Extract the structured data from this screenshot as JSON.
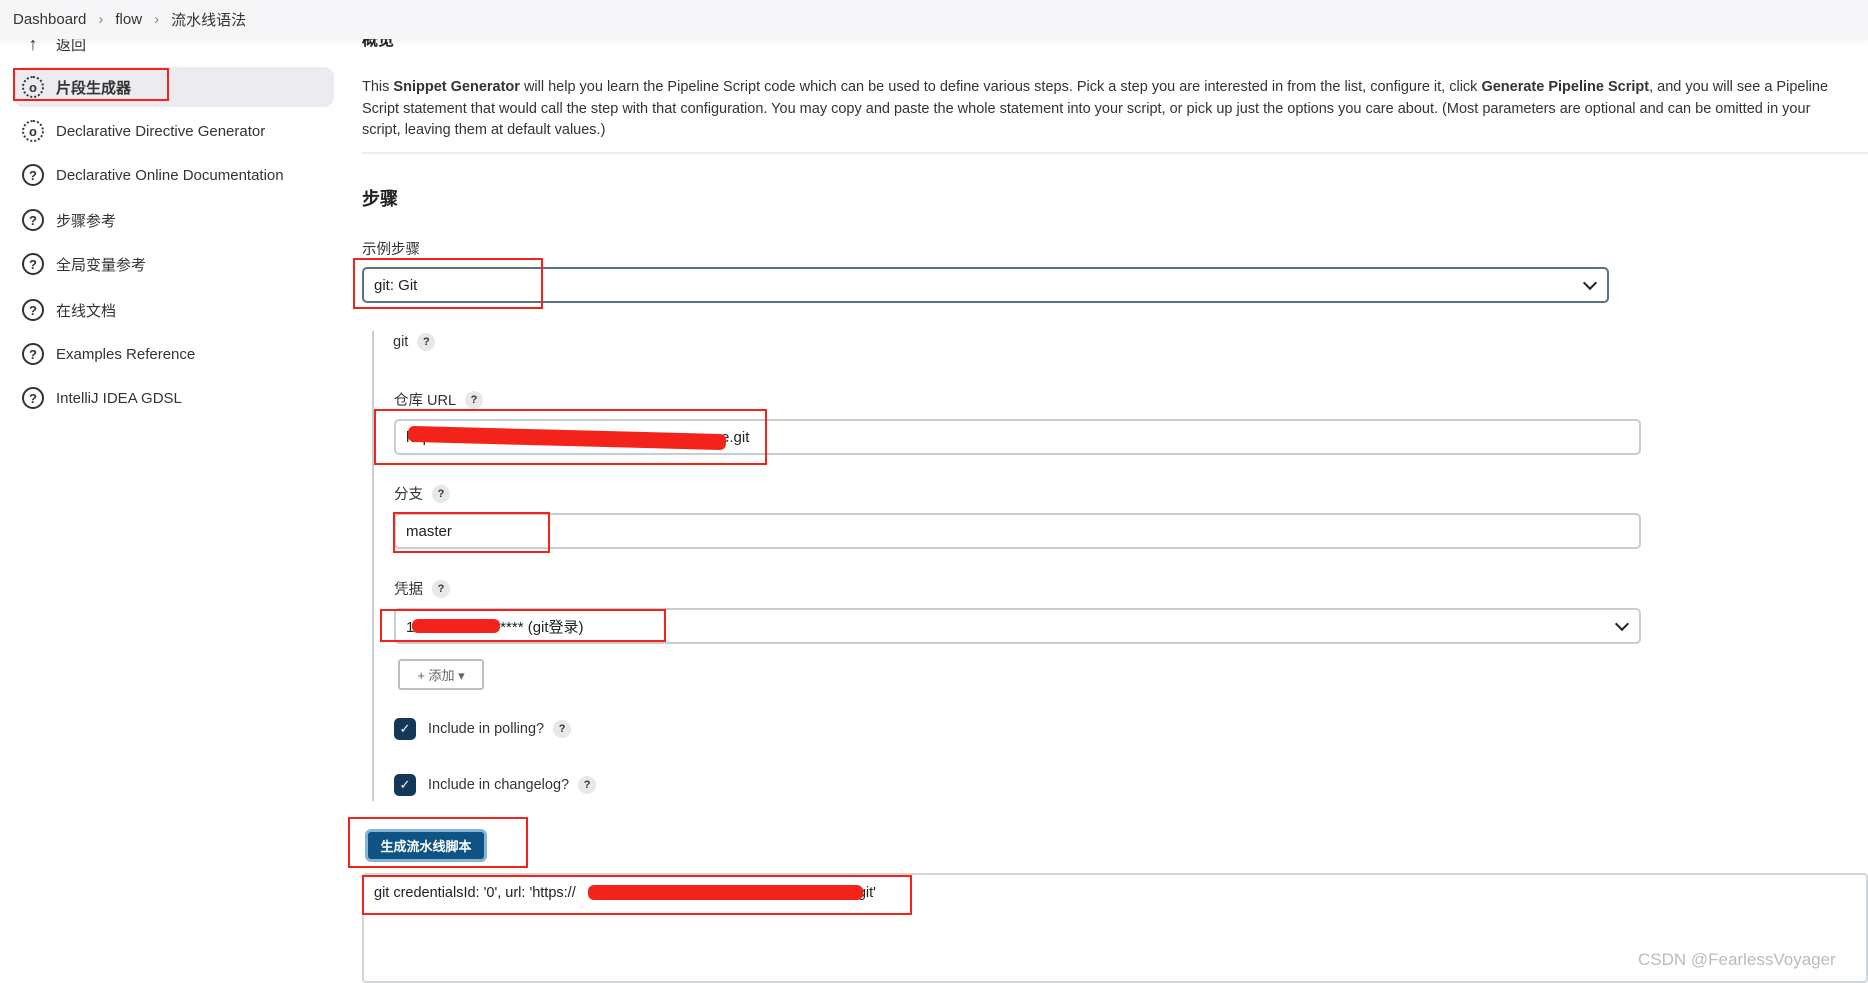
{
  "breadcrumb": [
    "Dashboard",
    "flow",
    "流水线语法"
  ],
  "sidebar": {
    "items": [
      {
        "label": "返回",
        "icon": "arrow-up-icon"
      },
      {
        "label": "片段生成器",
        "icon": "gear-icon",
        "active": true
      },
      {
        "label": "Declarative Directive Generator",
        "icon": "gear-icon"
      },
      {
        "label": "Declarative Online Documentation",
        "icon": "help-icon"
      },
      {
        "label": "步骤参考",
        "icon": "help-icon"
      },
      {
        "label": "全局变量参考",
        "icon": "help-icon"
      },
      {
        "label": "在线文档",
        "icon": "help-icon"
      },
      {
        "label": "Examples Reference",
        "icon": "help-icon"
      },
      {
        "label": "IntelliJ IDEA GDSL",
        "icon": "help-icon"
      }
    ]
  },
  "main": {
    "overview_heading": "概览",
    "desc_pre": "This ",
    "desc_b1": "Snippet Generator",
    "desc_mid": " will help you learn the Pipeline Script code which can be used to define various steps. Pick a step you are interested in from the list, configure it, click ",
    "desc_b2": "Generate Pipeline Script",
    "desc_post": ", and you will see a Pipeline Script statement that would call the step with that configuration. You may copy and paste the whole statement into your script, or pick up just the options you care about. (Most parameters are optional and can be omitted in your script, leaving them at default values.)",
    "steps_heading": "步骤",
    "sample_step_label": "示例步骤",
    "sample_step_value": "git: Git",
    "git_label": "git",
    "repo_url_label": "仓库 URL",
    "repo_url_prefix": "https://",
    "repo_url_suffix": "e.git",
    "branch_label": "分支",
    "branch_value": "master",
    "credentials_label": "凭据",
    "credentials_prefix": "1",
    "credentials_suffix": "/****** (git登录)",
    "add_button": "+ 添加 ▾",
    "polling_label": "Include in polling?",
    "changelog_label": "Include in changelog?",
    "polling_checked": true,
    "changelog_checked": true,
    "generate_button": "生成流水线脚本",
    "output_prefix": "git credentialsId: '0', url: 'https://",
    "output_suffix": "e.git'",
    "help": "?"
  },
  "watermark": "CSDN @FearlessVoyager",
  "colors": {
    "accent": "#14375a",
    "button": "#0e5384",
    "annotation": "#f3231b"
  }
}
